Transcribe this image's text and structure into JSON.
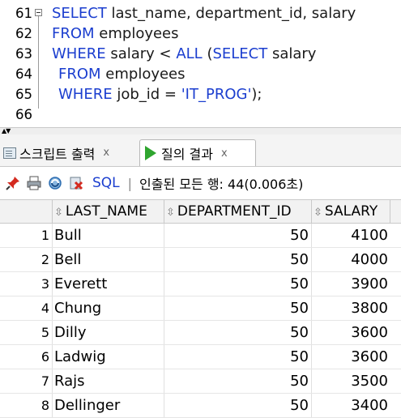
{
  "editor": {
    "lines": [
      {
        "num": "61",
        "tokens": [
          {
            "t": "SELECT",
            "c": "kw"
          },
          {
            "t": " last_name, department_id, salary",
            "c": "id"
          }
        ]
      },
      {
        "num": "62",
        "tokens": [
          {
            "t": "FROM",
            "c": "kw"
          },
          {
            "t": " employees",
            "c": "id"
          }
        ]
      },
      {
        "num": "63",
        "tokens": [
          {
            "t": "WHERE",
            "c": "kw"
          },
          {
            "t": " salary < ",
            "c": "id"
          },
          {
            "t": "ALL",
            "c": "kw"
          },
          {
            "t": " (",
            "c": "id"
          },
          {
            "t": "SELECT",
            "c": "kw"
          },
          {
            "t": " salary",
            "c": "id"
          }
        ]
      },
      {
        "num": "64",
        "tokens": [
          {
            "t": "FROM",
            "c": "kw"
          },
          {
            "t": " employees",
            "c": "id"
          }
        ]
      },
      {
        "num": "65",
        "tokens": [
          {
            "t": "WHERE",
            "c": "kw"
          },
          {
            "t": " job_id = ",
            "c": "id"
          },
          {
            "t": "'IT_PROG'",
            "c": "str"
          },
          {
            "t": ");",
            "c": "id"
          }
        ]
      },
      {
        "num": "66",
        "tokens": []
      }
    ]
  },
  "tabs": [
    {
      "label": "스크립트 출력",
      "close": "x",
      "icon": "script-output-icon"
    },
    {
      "label": "질의 결과",
      "close": "x",
      "icon": "run-query-icon"
    }
  ],
  "toolbar": {
    "sql_label": "SQL",
    "separator": "|",
    "fetch_status": "인출된 모든 행: 44(0.006초)"
  },
  "grid": {
    "columns": [
      "LAST_NAME",
      "DEPARTMENT_ID",
      "SALARY"
    ],
    "rows": [
      {
        "n": "1",
        "last_name": "Bull",
        "department_id": "50",
        "salary": "4100"
      },
      {
        "n": "2",
        "last_name": "Bell",
        "department_id": "50",
        "salary": "4000"
      },
      {
        "n": "3",
        "last_name": "Everett",
        "department_id": "50",
        "salary": "3900"
      },
      {
        "n": "4",
        "last_name": "Chung",
        "department_id": "50",
        "salary": "3800"
      },
      {
        "n": "5",
        "last_name": "Dilly",
        "department_id": "50",
        "salary": "3600"
      },
      {
        "n": "6",
        "last_name": "Ladwig",
        "department_id": "50",
        "salary": "3600"
      },
      {
        "n": "7",
        "last_name": "Rajs",
        "department_id": "50",
        "salary": "3500"
      },
      {
        "n": "8",
        "last_name": "Dellinger",
        "department_id": "50",
        "salary": "3400"
      }
    ]
  },
  "colors": {
    "keyword": "#1b3ecf",
    "tab_active_bg": "#ffffff",
    "header_bg": "#f2f2f2"
  }
}
